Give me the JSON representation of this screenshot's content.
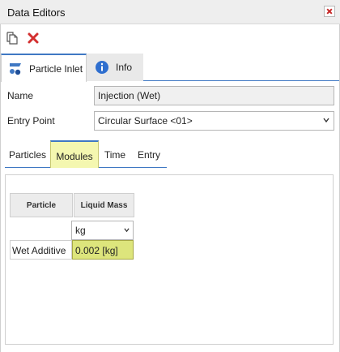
{
  "window": {
    "title": "Data Editors"
  },
  "toolbar": {
    "copy_icon": "copy-icon",
    "delete_icon": "delete-icon"
  },
  "main_tabs": [
    {
      "label": "Particle Inlet",
      "icon": "particle-inlet-icon",
      "active": true
    },
    {
      "label": "Info",
      "icon": "info-icon",
      "active": false
    }
  ],
  "fields": {
    "name_label": "Name",
    "name_value": "Injection (Wet)",
    "entry_label": "Entry Point",
    "entry_value": "Circular Surface <01>"
  },
  "sub_tabs": [
    {
      "label": "Particles",
      "active": false
    },
    {
      "label": "Modules",
      "active": true
    },
    {
      "label": "Time",
      "active": false
    },
    {
      "label": "Entry",
      "active": false
    }
  ],
  "grid": {
    "headers": [
      "Particle",
      "Liquid Mass"
    ],
    "unit": "kg",
    "rows": [
      {
        "label": "Wet Additive",
        "value": "0.002 [kg]"
      }
    ]
  },
  "colors": {
    "accent": "#3f78c3",
    "highlight": "#dde57c",
    "tab_highlight": "#f4f7b0",
    "delete": "#d32f2f"
  }
}
